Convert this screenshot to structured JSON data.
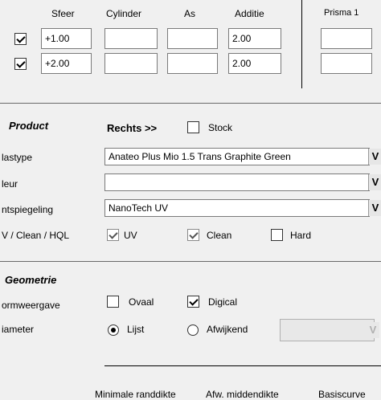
{
  "prescription": {
    "headers": {
      "sfeer": "Sfeer",
      "cylinder": "Cylinder",
      "as": "As",
      "additie": "Additie",
      "prisma": "Prisma 1"
    },
    "rows": [
      {
        "checked": true,
        "sfeer": "+1.00",
        "cylinder": "",
        "as": "",
        "additie": "2.00",
        "prisma": ""
      },
      {
        "checked": true,
        "sfeer": "+2.00",
        "cylinder": "",
        "as": "",
        "additie": "2.00",
        "prisma": ""
      }
    ]
  },
  "product": {
    "title": "Product",
    "side_label": "Rechts >>",
    "stock_label": "Stock",
    "stock_checked": false,
    "glastype_label": "lastype",
    "glastype_value": "Anateo Plus Mio 1.5 Trans Graphite Green",
    "kleur_label": "leur",
    "kleur_value": "",
    "ontspiegeling_label": "ntspiegeling",
    "ontspiegeling_value": "NanoTech UV",
    "uv_row_label": "V / Clean / HQL",
    "uv_label": "UV",
    "uv_checked": true,
    "clean_label": "Clean",
    "clean_checked": true,
    "hard_label": "Hard",
    "hard_checked": false
  },
  "geometrie": {
    "title": "Geometrie",
    "vormweergave_label": "ormweergave",
    "ovaal_label": "Ovaal",
    "ovaal_checked": false,
    "digical_label": "Digical",
    "digical_checked": true,
    "diameter_label": "iameter",
    "lijst_label": "Lijst",
    "lijst_selected": true,
    "afwijkend_label": "Afwijkend",
    "afwijkend_selected": false,
    "afwijkend_value": ""
  },
  "footer": {
    "min_randdikte": "Minimale randdikte",
    "afw_middendikte": "Afw. middendikte",
    "basiscurve": "Basiscurve"
  },
  "colors": {
    "background": "#f0f0f0",
    "field": "#ffffff",
    "border": "#7a7a7a"
  }
}
